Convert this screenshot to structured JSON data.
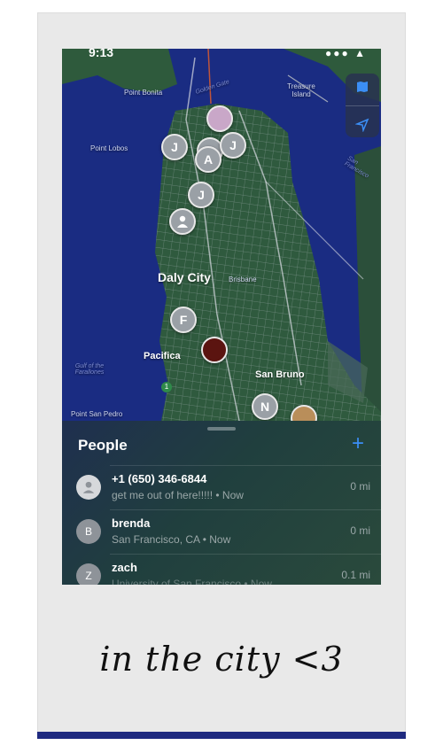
{
  "status": {
    "time": "9:13",
    "signal": "●●●  ▲"
  },
  "map": {
    "places": {
      "point_bonita": "Point Bonita",
      "golden_gate": "Golden Gate",
      "treasure_island": "Treasure Island",
      "point_lobos": "Point Lobos",
      "san_francisco": "San Francisco",
      "daly_city": "Daly City",
      "brisbane": "Brisbane",
      "pacifica": "Pacifica",
      "gulf_farallones": "Gulf of the Farallones",
      "san_bruno": "San Bruno",
      "point_san_pedro": "Point San Pedro",
      "route_1": "1"
    },
    "pins": [
      "J",
      "A",
      "J",
      "J",
      "F",
      "N"
    ]
  },
  "controls": {
    "map_icon": "map-icon",
    "location_icon": "location-arrow-icon"
  },
  "people": {
    "title": "People",
    "add_label": "+",
    "rows": [
      {
        "initial": "",
        "name": "+1 (650) 346-6844",
        "subtitle": "get me out of here!!!!! • Now",
        "distance": "0 mi"
      },
      {
        "initial": "B",
        "name": "brenda",
        "subtitle": "San Francisco, CA • Now",
        "distance": "0 mi"
      },
      {
        "initial": "Z",
        "name": "zach",
        "subtitle": "University of San Francisco • Now",
        "distance": "0.1 mi"
      }
    ]
  },
  "caption": "in the city <3",
  "colors": {
    "ocean": "#1a2c82",
    "land": "#2f5a3e",
    "accent": "#3b8ef5"
  }
}
